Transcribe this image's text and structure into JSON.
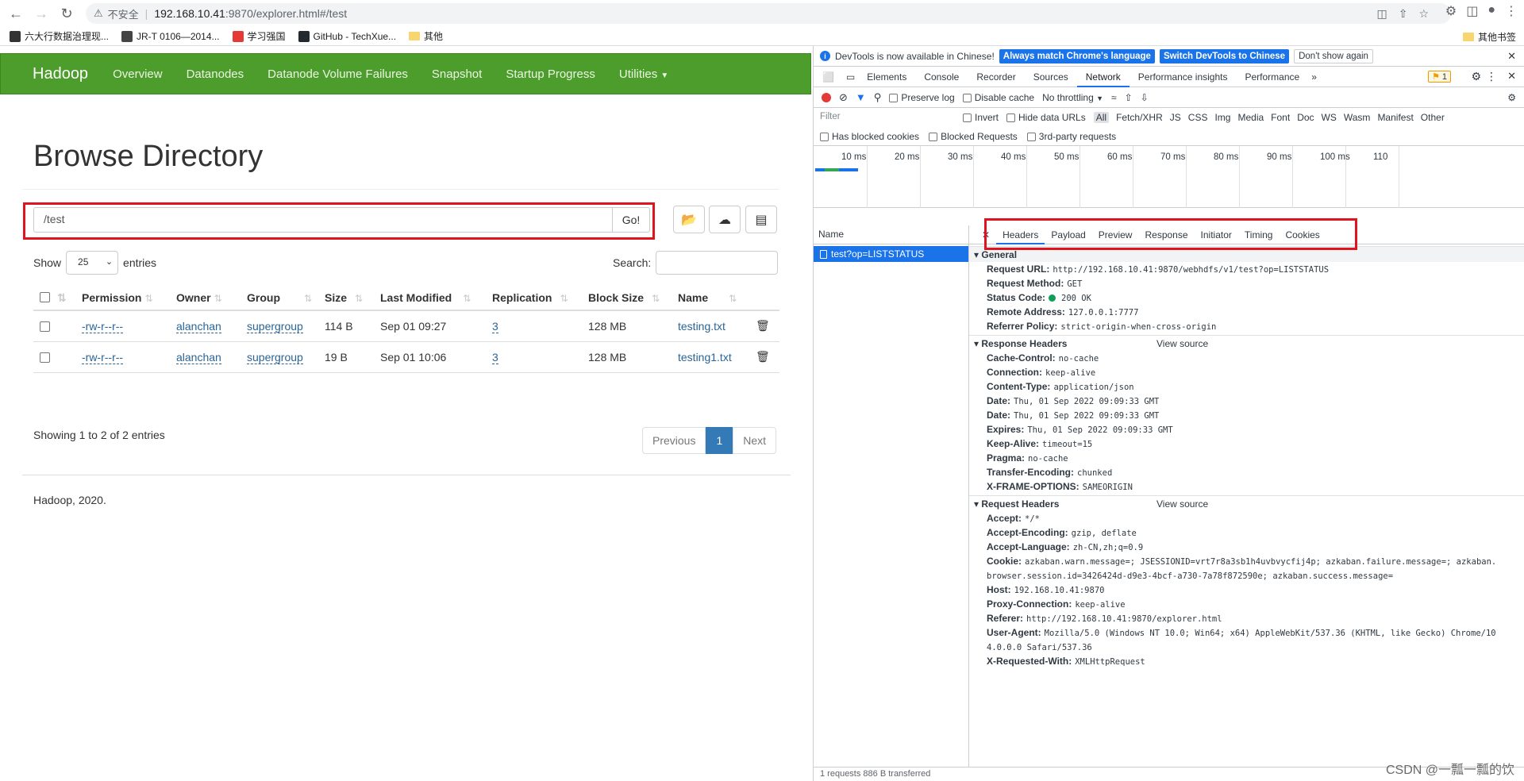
{
  "browser": {
    "security_label": "不安全",
    "url_host": "192.168.10.41",
    "url_path": ":9870/explorer.html#/test",
    "bookmarks": [
      {
        "label": "六大行数据治理现...",
        "color": "#333333",
        "icon": "bookmark-icon"
      },
      {
        "label": "JR-T 0106—2014...",
        "color": "#444444",
        "icon": "book-icon"
      },
      {
        "label": "学习强国",
        "color": "#e53935",
        "icon": "xuexi-icon"
      },
      {
        "label": "GitHub - TechXue...",
        "color": "#24292e",
        "icon": "github-icon"
      },
      {
        "label": "其他",
        "color": "#f9d56e",
        "icon": "folder-icon"
      }
    ],
    "other_bookmarks": "其他书签"
  },
  "hadoop": {
    "brand": "Hadoop",
    "nav": [
      "Overview",
      "Datanodes",
      "Datanode Volume Failures",
      "Snapshot",
      "Startup Progress",
      "Utilities"
    ],
    "title": "Browse Directory",
    "path_value": "/test",
    "go_label": "Go!",
    "show_label": "Show",
    "entries_value": "25",
    "entries_label": "entries",
    "search_label": "Search:",
    "columns": [
      "Permission",
      "Owner",
      "Group",
      "Size",
      "Last Modified",
      "Replication",
      "Block Size",
      "Name"
    ],
    "rows": [
      {
        "permission": "-rw-r--r--",
        "owner": "alanchan",
        "group": "supergroup",
        "size": "114 B",
        "modified": "Sep 01 09:27",
        "replication": "3",
        "block": "128 MB",
        "name": "testing.txt"
      },
      {
        "permission": "-rw-r--r--",
        "owner": "alanchan",
        "group": "supergroup",
        "size": "19 B",
        "modified": "Sep 01 10:06",
        "replication": "3",
        "block": "128 MB",
        "name": "testing1.txt"
      }
    ],
    "info": "Showing 1 to 2 of 2 entries",
    "pager": {
      "prev": "Previous",
      "current": "1",
      "next": "Next"
    },
    "footer": "Hadoop, 2020."
  },
  "devtools": {
    "notice": "DevTools is now available in Chinese!",
    "btn_match": "Always match Chrome's language",
    "btn_switch": "Switch DevTools to Chinese",
    "btn_dont": "Don't show again",
    "tabs": [
      "Elements",
      "Console",
      "Recorder",
      "Sources",
      "Network",
      "Performance insights",
      "Performance"
    ],
    "active_tab": "Network",
    "badge": "1",
    "preserve_log": "Preserve log",
    "disable_cache": "Disable cache",
    "throttling": "No throttling",
    "filter_placeholder": "Filter",
    "invert": "Invert",
    "hide_data_urls": "Hide data URLs",
    "types": [
      "All",
      "Fetch/XHR",
      "JS",
      "CSS",
      "Img",
      "Media",
      "Font",
      "Doc",
      "WS",
      "Wasm",
      "Manifest",
      "Other"
    ],
    "blocked_cookies": "Has blocked cookies",
    "blocked_requests": "Blocked Requests",
    "third_party": "3rd-party requests",
    "timeline_ticks": [
      "10 ms",
      "20 ms",
      "30 ms",
      "40 ms",
      "50 ms",
      "60 ms",
      "70 ms",
      "80 ms",
      "90 ms",
      "100 ms",
      "110"
    ],
    "name_col": "Name",
    "request_name": "test?op=LISTSTATUS",
    "detail_tabs": [
      "Headers",
      "Payload",
      "Preview",
      "Response",
      "Initiator",
      "Timing",
      "Cookies"
    ],
    "general_title": "General",
    "general": [
      {
        "k": "Request URL:",
        "v": "http://192.168.10.41:9870/webhdfs/v1/test?op=LISTSTATUS"
      },
      {
        "k": "Request Method:",
        "v": "GET"
      },
      {
        "k": "Status Code:",
        "v": "200 OK"
      },
      {
        "k": "Remote Address:",
        "v": "127.0.0.1:7777"
      },
      {
        "k": "Referrer Policy:",
        "v": "strict-origin-when-cross-origin"
      }
    ],
    "response_title": "Response Headers",
    "view_source": "View source",
    "response": [
      {
        "k": "Cache-Control:",
        "v": "no-cache"
      },
      {
        "k": "Connection:",
        "v": "keep-alive"
      },
      {
        "k": "Content-Type:",
        "v": "application/json"
      },
      {
        "k": "Date:",
        "v": "Thu, 01 Sep 2022 09:09:33 GMT"
      },
      {
        "k": "Date:",
        "v": "Thu, 01 Sep 2022 09:09:33 GMT"
      },
      {
        "k": "Expires:",
        "v": "Thu, 01 Sep 2022 09:09:33 GMT"
      },
      {
        "k": "Keep-Alive:",
        "v": "timeout=15"
      },
      {
        "k": "Pragma:",
        "v": "no-cache"
      },
      {
        "k": "Transfer-Encoding:",
        "v": "chunked"
      },
      {
        "k": "X-FRAME-OPTIONS:",
        "v": "SAMEORIGIN"
      }
    ],
    "request_title": "Request Headers",
    "request": [
      {
        "k": "Accept:",
        "v": "*/*"
      },
      {
        "k": "Accept-Encoding:",
        "v": "gzip, deflate"
      },
      {
        "k": "Accept-Language:",
        "v": "zh-CN,zh;q=0.9"
      },
      {
        "k": "Cookie:",
        "v": "azkaban.warn.message=; JSESSIONID=vrt7r8a3sb1h4uvbvycfij4p; azkaban.failure.message=; azkaban."
      },
      {
        "k": "",
        "v": "browser.session.id=3426424d-d9e3-4bcf-a730-7a78f872590e; azkaban.success.message="
      },
      {
        "k": "Host:",
        "v": "192.168.10.41:9870"
      },
      {
        "k": "Proxy-Connection:",
        "v": "keep-alive"
      },
      {
        "k": "Referer:",
        "v": "http://192.168.10.41:9870/explorer.html"
      },
      {
        "k": "User-Agent:",
        "v": "Mozilla/5.0 (Windows NT 10.0; Win64; x64) AppleWebKit/537.36 (KHTML, like Gecko) Chrome/10"
      },
      {
        "k": "",
        "v": "4.0.0.0 Safari/537.36"
      },
      {
        "k": "X-Requested-With:",
        "v": "XMLHttpRequest"
      }
    ],
    "status_footer": "1 requests   886 B transferred"
  },
  "watermark": "CSDN @一瓢一瓢的饮"
}
